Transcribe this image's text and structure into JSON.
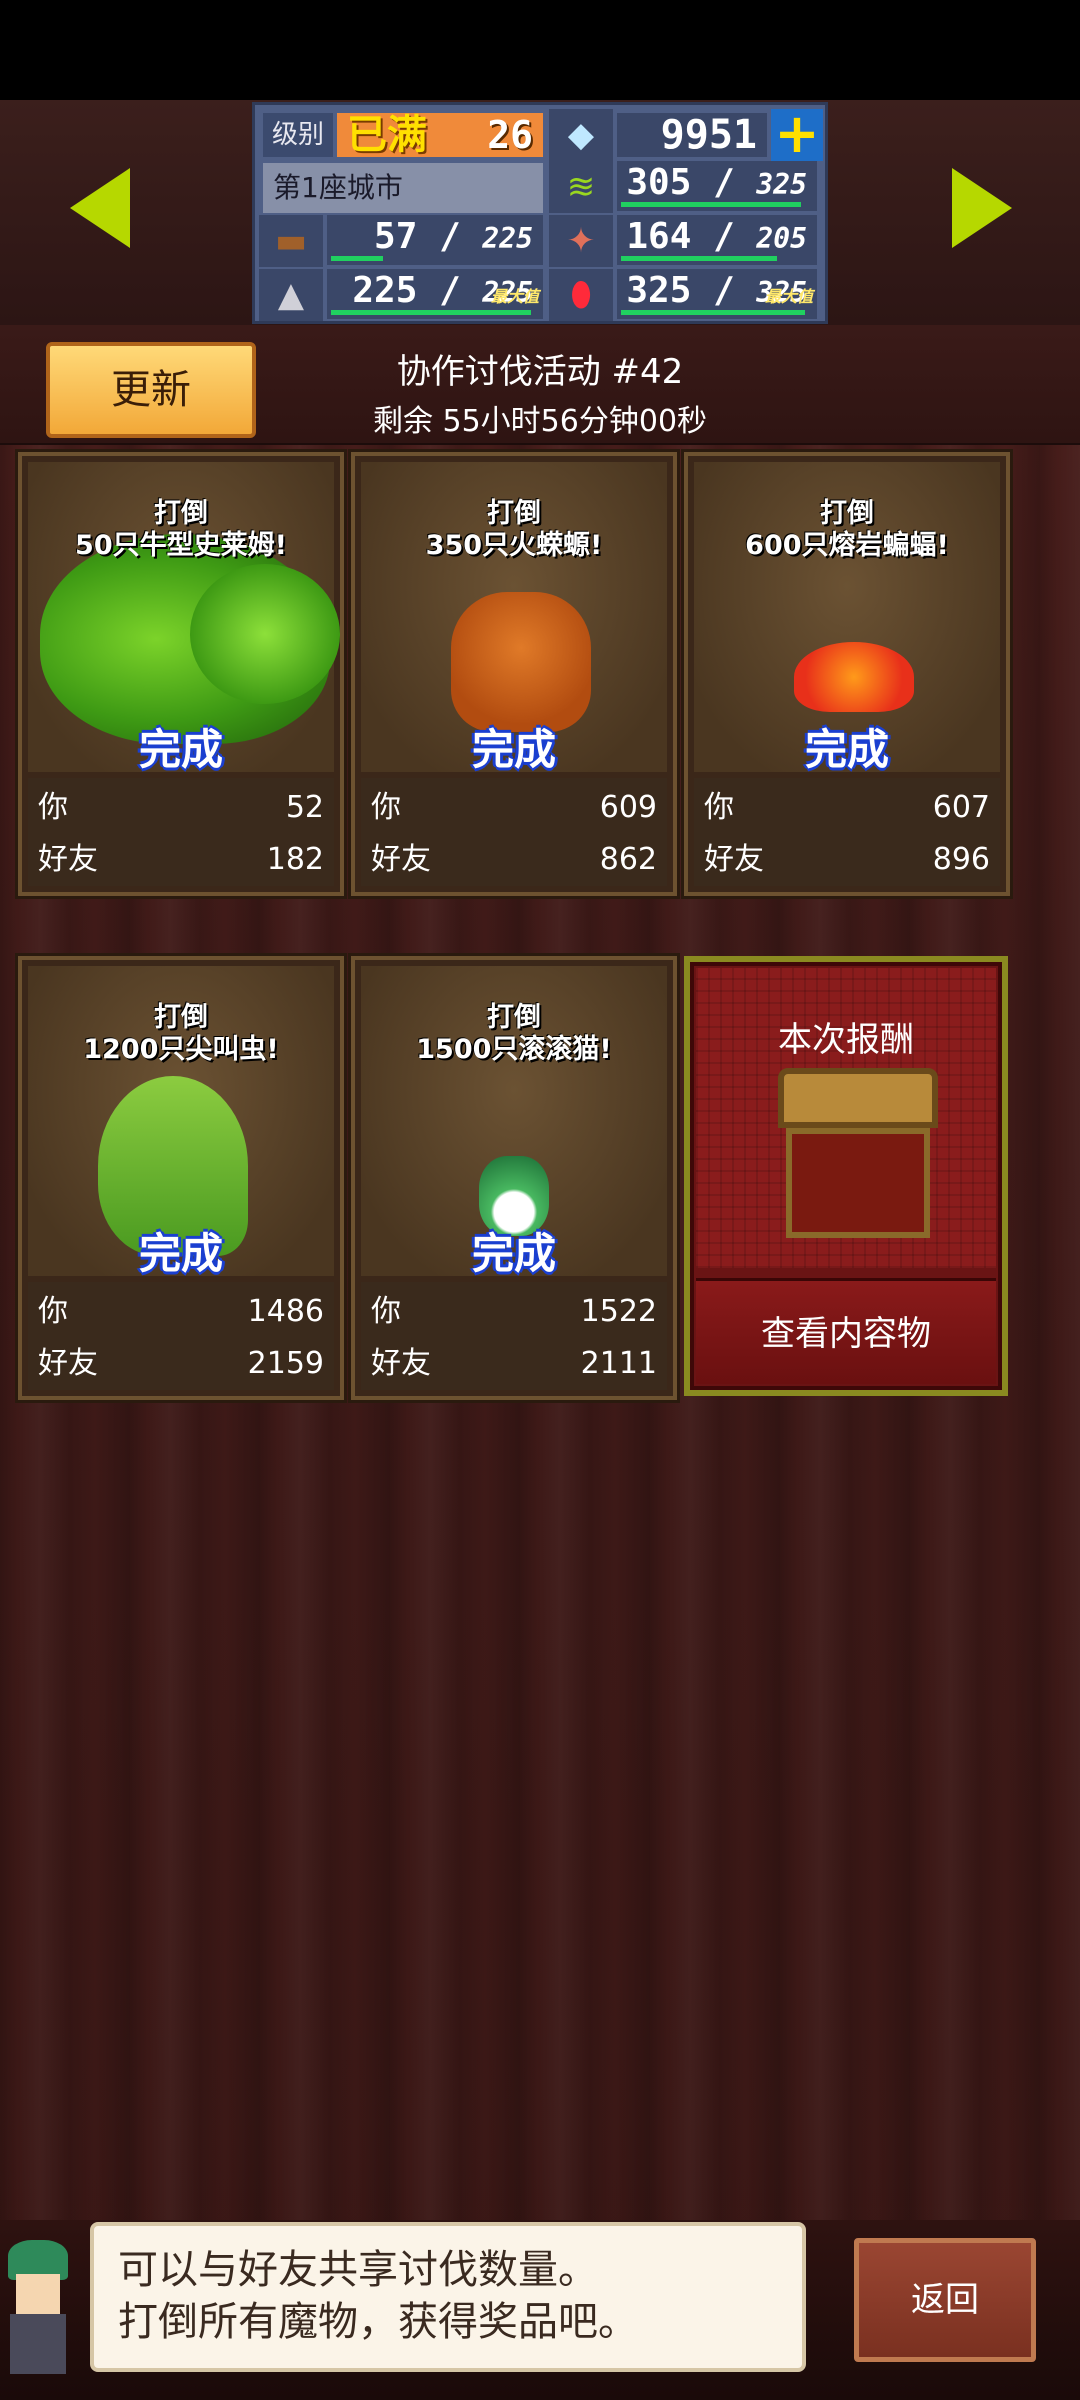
{
  "stats": {
    "level_label": "级别",
    "level_max": "已满",
    "level_value": "26",
    "gems": "9951",
    "plus": "+",
    "city_name": "第1座城市",
    "resources": [
      {
        "icon": "grass-icon",
        "value": "305",
        "max": "325",
        "fill": 0.94
      },
      {
        "icon": "wood-icon",
        "value": "57",
        "max": "225",
        "fill": 0.25
      },
      {
        "icon": "meat-icon",
        "value": "164",
        "max": "205",
        "fill": 0.8
      },
      {
        "icon": "stone-icon",
        "value": "225",
        "max": "225",
        "fill": 1.0,
        "max_tag": "最大值"
      },
      {
        "icon": "ruby-icon",
        "value": "325",
        "max": "325",
        "fill": 1.0,
        "max_tag": "最大值"
      }
    ]
  },
  "header": {
    "update_label": "更新",
    "event_title": "协作讨伐活动 #42",
    "event_timer": "剩余 55小时56分钟00秒"
  },
  "cards": [
    {
      "goal_line1": "打倒",
      "goal_line2": "50只牛型史莱姆!",
      "status": "完成",
      "you_label": "你",
      "you_value": "52",
      "friend_label": "好友",
      "friend_value": "182",
      "monster": "slime-monster"
    },
    {
      "goal_line1": "打倒",
      "goal_line2": "350只火蝾螈!",
      "status": "完成",
      "you_label": "你",
      "you_value": "609",
      "friend_label": "好友",
      "friend_value": "862",
      "monster": "fire-salamander-monster"
    },
    {
      "goal_line1": "打倒",
      "goal_line2": "600只熔岩蝙蝠!",
      "status": "完成",
      "you_label": "你",
      "you_value": "607",
      "friend_label": "好友",
      "friend_value": "896",
      "monster": "lava-bat-monster"
    },
    {
      "goal_line1": "打倒",
      "goal_line2": "1200只尖叫虫!",
      "status": "完成",
      "you_label": "你",
      "you_value": "1486",
      "friend_label": "好友",
      "friend_value": "2159",
      "monster": "screaming-worm-monster"
    },
    {
      "goal_line1": "打倒",
      "goal_line2": "1500只滚滚猫!",
      "status": "完成",
      "you_label": "你",
      "you_value": "1522",
      "friend_label": "好友",
      "friend_value": "2111",
      "monster": "rolling-cat-monster"
    }
  ],
  "reward": {
    "title": "本次报酬",
    "view_label": "查看内容物"
  },
  "footer": {
    "message_line1": "可以与好友共享讨伐数量。",
    "message_line2": "打倒所有魔物，获得奖品吧。",
    "back_label": "返回"
  }
}
